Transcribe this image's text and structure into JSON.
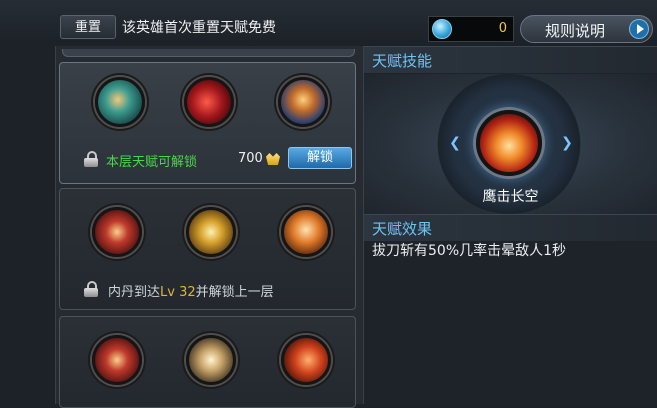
{
  "top_bar": {
    "reset_label": "重置",
    "reset_note": "该英雄首次重置天赋免费",
    "gem_count": "0",
    "rules_label": "规则说明"
  },
  "tiers": [
    {
      "state": "unlockable",
      "skill_icons": [
        "teal-slash-icon",
        "red-warrior-icon",
        "blue-mage-icon"
      ],
      "unlock_text": "本层天赋可解锁",
      "cost": "700",
      "unlock_button": "解锁"
    },
    {
      "state": "locked",
      "skill_icons": [
        "red-blade-icon",
        "golden-blade-icon",
        "fire-slash-icon"
      ],
      "req_prefix": "内丹到达",
      "req_level": "Lv 32",
      "req_suffix": "并解锁上一层"
    },
    {
      "state": "locked",
      "skill_icons": [
        "red-blade-icon",
        "spear-strike-icon",
        "flame-swirl-icon"
      ]
    }
  ],
  "right_panel": {
    "skill_section_title": "天赋技能",
    "featured_skill_name": "鹰击长空",
    "effect_section_title": "天赋效果",
    "effect_text": "拔刀斩有50%几率击晕敌人1秒"
  },
  "colors": {
    "accent_blue": "#6ec4f3",
    "unlock_green": "#48d64b",
    "level_gold": "#e0b33a"
  }
}
